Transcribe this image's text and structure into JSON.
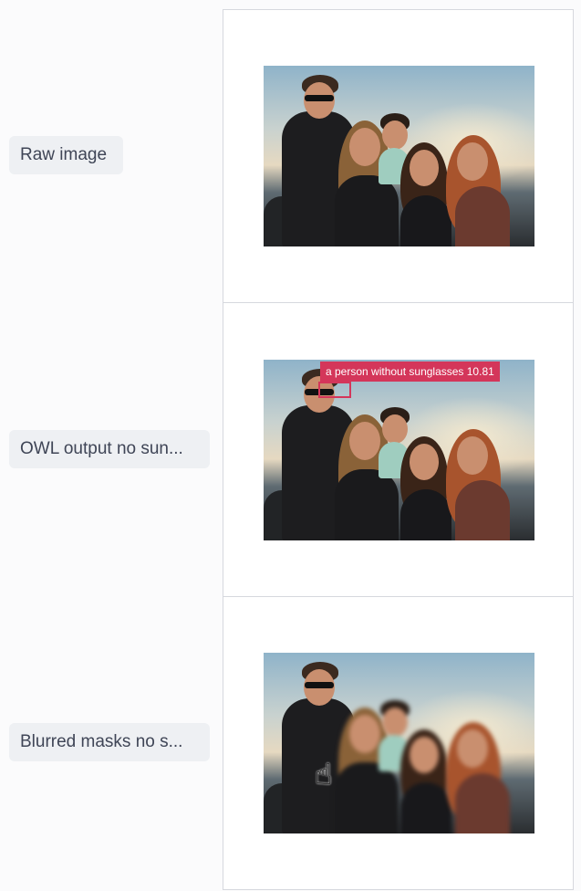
{
  "rows": [
    {
      "label": "Raw image"
    },
    {
      "label": "OWL output no sun..."
    },
    {
      "label": "Blurred masks no s..."
    }
  ],
  "detection": {
    "label": "a person without sunglasses 10.81"
  },
  "colors": {
    "detection": "#d4365a",
    "label_bg": "#eef0f3",
    "border": "#d6d8de"
  },
  "icons": {
    "cursor": "hand-pointer-icon"
  }
}
